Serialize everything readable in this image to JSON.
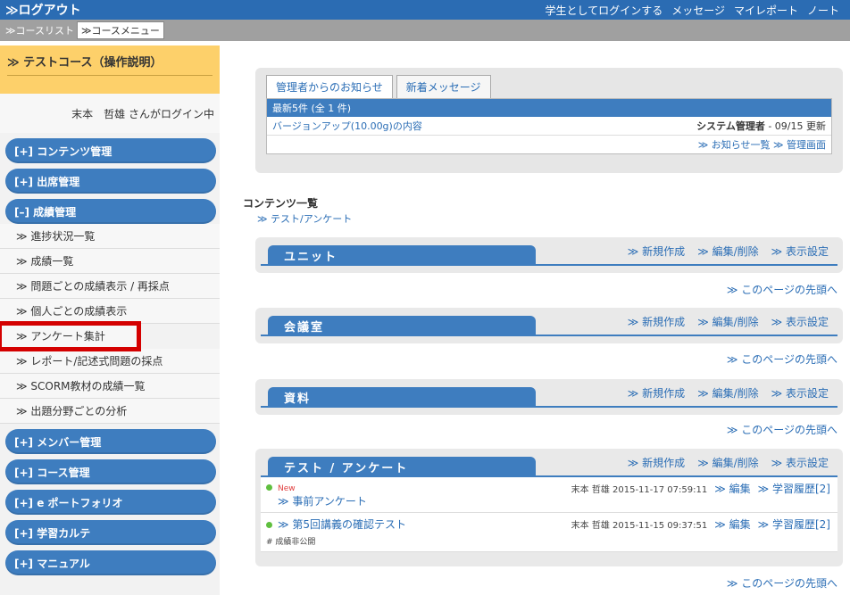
{
  "topbar": {
    "logout": "≫ログアウト",
    "links": [
      "学生としてログインする",
      "メッセージ",
      "マイレポート",
      "ノート"
    ]
  },
  "breadcrumb": {
    "course_list": "≫コースリスト",
    "course_menu": "≫コースメニュー"
  },
  "sidebar": {
    "course_title": "≫ テストコース（操作説明）",
    "user_line": "末本　哲雄 さんがログイン中",
    "menus": [
      {
        "label": "[+] コンテンツ管理"
      },
      {
        "label": "[+] 出席管理"
      },
      {
        "label": "[–] 成績管理"
      }
    ],
    "sub_items": [
      "≫ 進捗状況一覧",
      "≫ 成績一覧",
      "≫ 問題ごとの成績表示 / 再採点",
      "≫ 個人ごとの成績表示",
      "≫ アンケート集計",
      "≫ レポート/記述式問題の採点",
      "≫ SCORM教材の成績一覧",
      "≫ 出題分野ごとの分析"
    ],
    "menus_after": [
      "[+] メンバー管理",
      "[+] コース管理",
      "[+] e ポートフォリオ",
      "[+] 学習カルテ",
      "[+] マニュアル"
    ]
  },
  "notice": {
    "tab_admin": "管理者からのお知らせ",
    "tab_new": "新着メッセージ",
    "header": "最新5件 (全 1 件)",
    "item_title": "バージョンアップ(10.00g)の内容",
    "item_meta": "システム管理者",
    "item_date": " - 09/15 更新",
    "link_list": "≫ お知らせ一覧",
    "link_admin": "≫ 管理画面"
  },
  "contents": {
    "label": "コンテンツ一覧",
    "sublink": "≫ テスト/アンケート"
  },
  "actions": {
    "new": "≫ 新規作成",
    "edit": "≫ 編集/削除",
    "display": "≫ 表示設定",
    "page_top": "≫ このページの先頭へ"
  },
  "blocks": {
    "unit": "ユニット",
    "meeting": "会議室",
    "material": "資料",
    "test": "テスト / アンケート"
  },
  "tests": [
    {
      "badge": "New",
      "title": "≫ 事前アンケート",
      "meta": "末本 哲雄 2015-11-17 07:59:11",
      "edit": "≫ 編集",
      "history": "≫ 学習履歴[2]"
    },
    {
      "title": "≫ 第5回講義の確認テスト",
      "meta": "末本 哲雄 2015-11-15 09:37:51",
      "edit": "≫ 編集",
      "history": "≫ 学習履歴[2]",
      "status": "# 成績非公開"
    }
  ],
  "colors": {
    "topbar": "#2b6cb3",
    "menu": "#3e7dbf",
    "course_title": "#fdd06a",
    "highlight": "#d40000"
  }
}
